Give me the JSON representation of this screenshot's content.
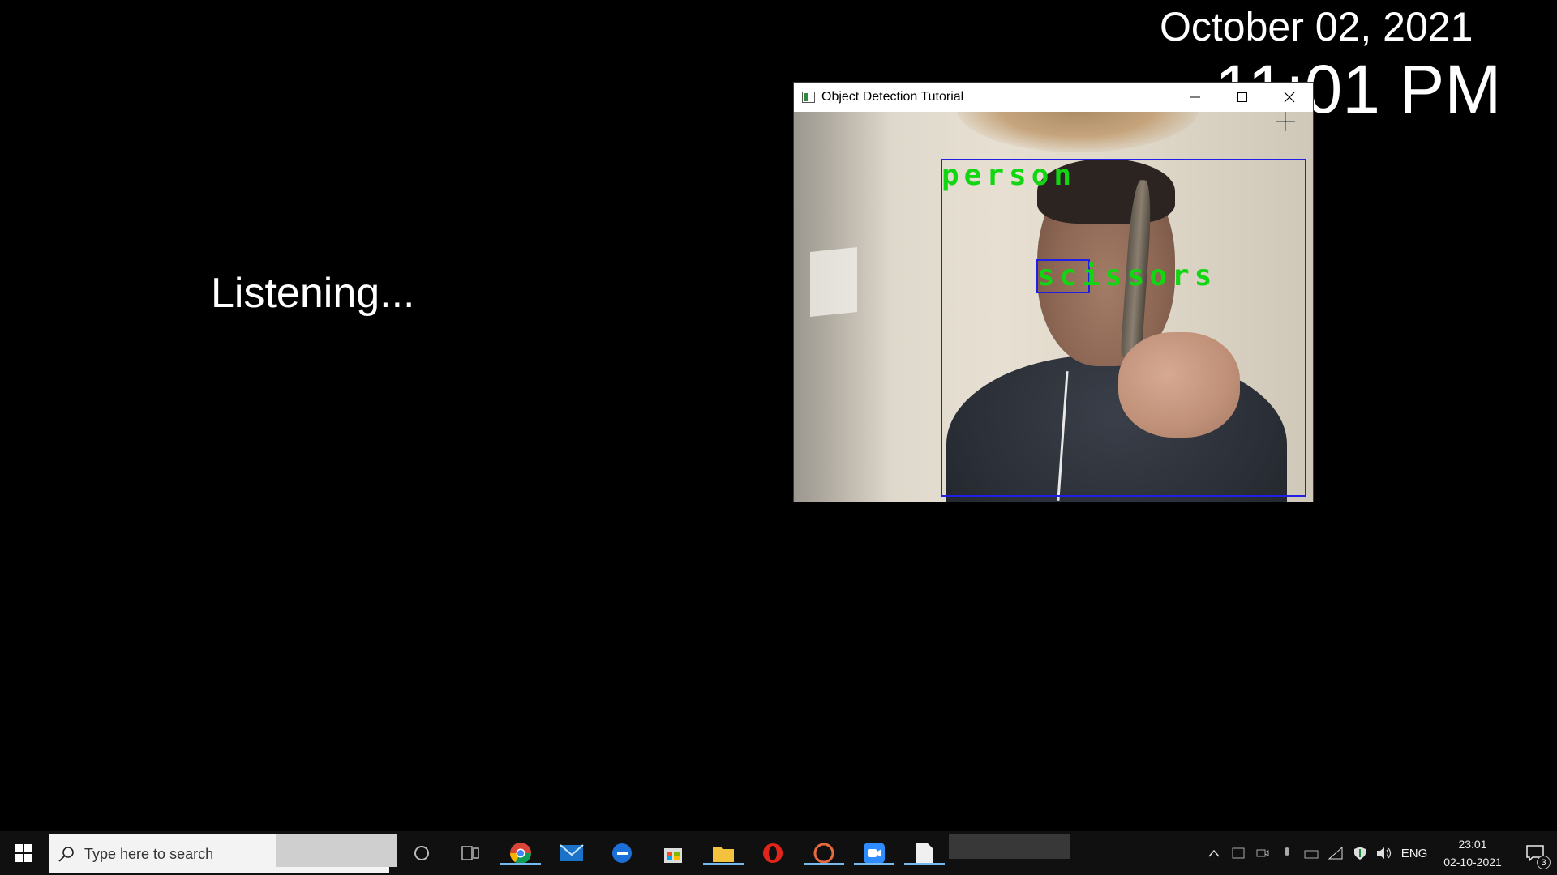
{
  "desktop": {
    "date": "October 02, 2021",
    "time": "11:01 PM",
    "status": "Listening..."
  },
  "window": {
    "title": "Object Detection Tutorial",
    "detections": [
      {
        "label": "person"
      },
      {
        "label": "scissors"
      }
    ]
  },
  "taskbar": {
    "search_placeholder": "Type here to search",
    "apps": [
      "cortana-icon",
      "task-view-icon",
      "chrome-icon",
      "mail-icon",
      "edge-icon",
      "store-icon",
      "file-explorer-icon",
      "opera-icon",
      "app-icon",
      "zoom-icon",
      "notepad-icon"
    ],
    "language": "ENG",
    "clock_time": "23:01",
    "clock_date": "02-10-2021",
    "notification_count": "3"
  },
  "colors": {
    "bbox": "#1f1fe6",
    "label": "#11d611",
    "taskbar": "#101010"
  }
}
